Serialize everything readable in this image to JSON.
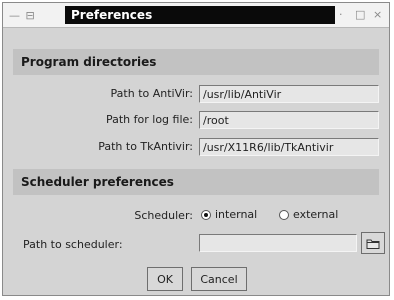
{
  "window": {
    "title": "Preferences",
    "controls": {
      "left": "— ⊟",
      "minimize": "·",
      "maximize": "□",
      "close": "×"
    }
  },
  "program_directories": {
    "header": "Program directories",
    "antivir": {
      "label": "Path to AntiVir:",
      "value": "/usr/lib/AntiVir"
    },
    "logfile": {
      "label": "Path for log file:",
      "value": "/root"
    },
    "tkantivir": {
      "label": "Path to TkAntivir:",
      "value": "/usr/X11R6/lib/TkAntivir"
    }
  },
  "scheduler_preferences": {
    "header": "Scheduler preferences",
    "scheduler_label": "Scheduler:",
    "options": [
      {
        "label": "internal",
        "selected": true
      },
      {
        "label": "external",
        "selected": false
      }
    ],
    "path_label": "Path to scheduler:",
    "path_value": "",
    "browse_icon": "folder-icon"
  },
  "buttons": {
    "ok": "OK",
    "cancel": "Cancel"
  }
}
